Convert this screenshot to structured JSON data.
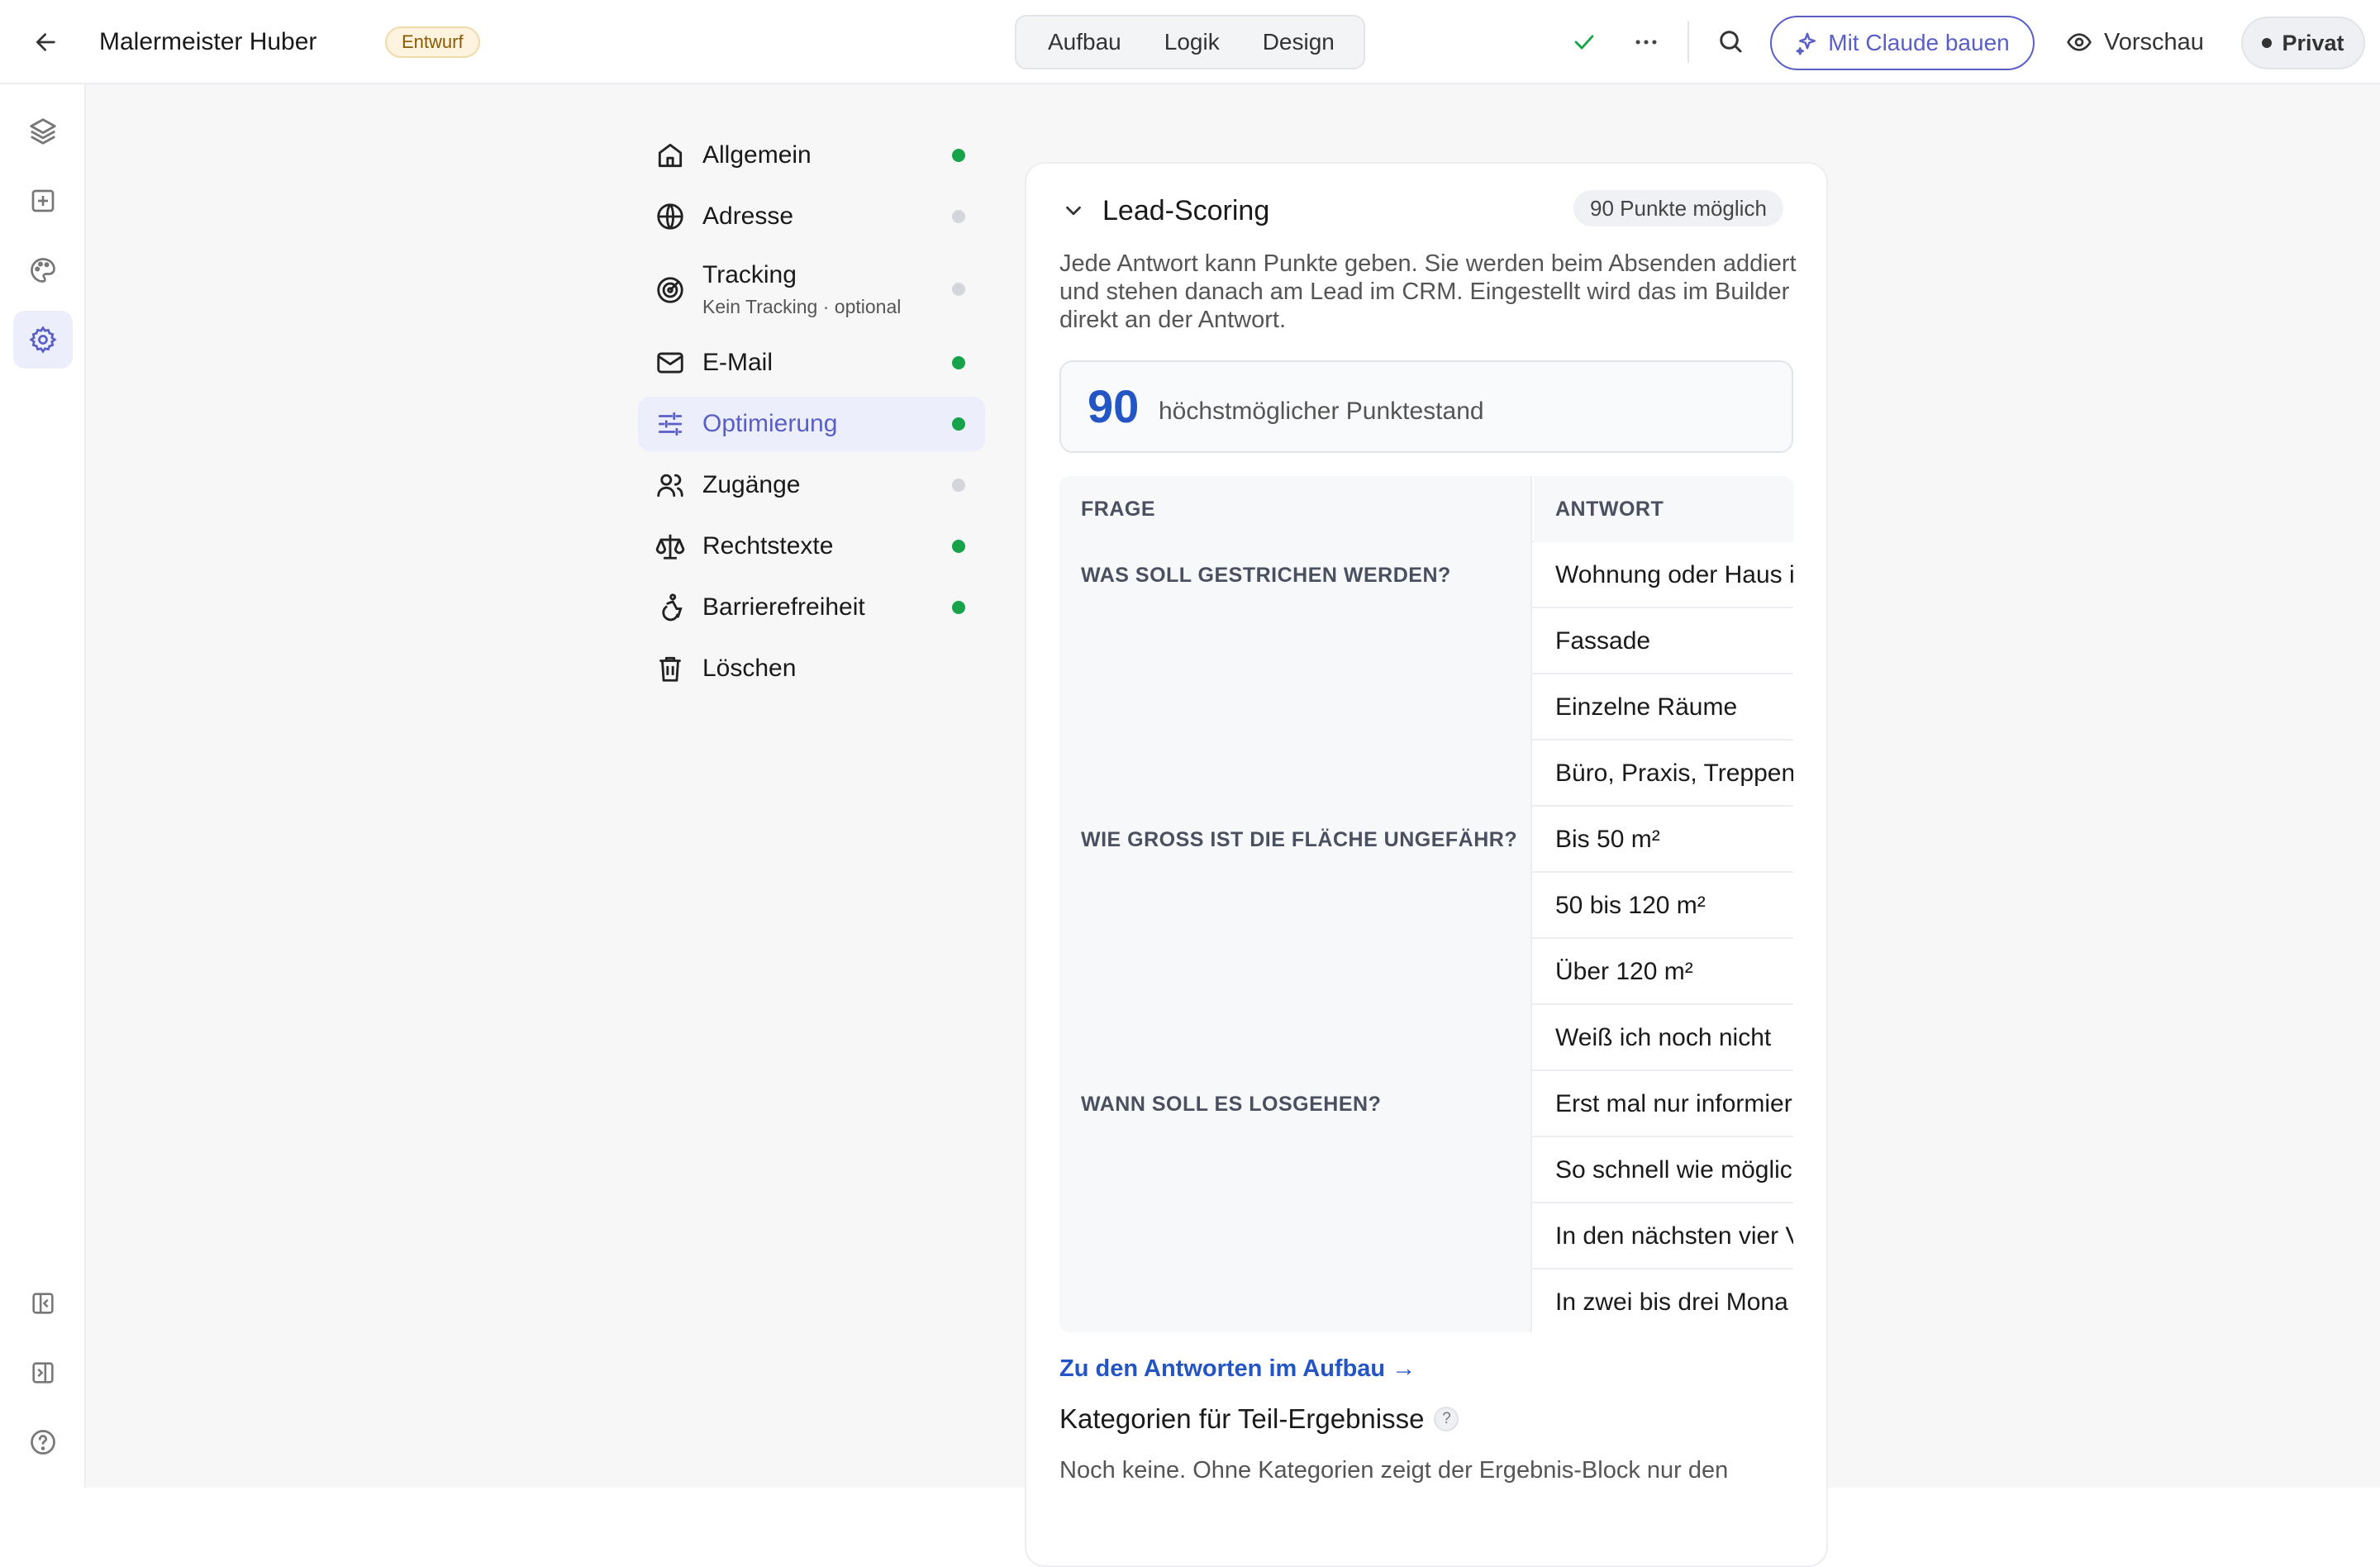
{
  "header": {
    "title": "Malermeister Huber",
    "status_badge": "Entwurf",
    "tabs": [
      {
        "label": "Aufbau"
      },
      {
        "label": "Logik"
      },
      {
        "label": "Design"
      }
    ],
    "claude_button": "Mit Claude bauen",
    "preview_button": "Vorschau",
    "visibility_button": "Privat"
  },
  "settings_nav": {
    "items": [
      {
        "label": "Allgemein",
        "status_color": "#16a34a"
      },
      {
        "label": "Adresse",
        "status_color": "#d4d6dc"
      },
      {
        "label": "Tracking",
        "sublabel": "Kein Tracking · optional",
        "status_color": "#d4d6dc"
      },
      {
        "label": "E-Mail",
        "status_color": "#16a34a"
      },
      {
        "label": "Optimierung",
        "status_color": "#16a34a",
        "active": true
      },
      {
        "label": "Zugänge",
        "status_color": "#d4d6dc"
      },
      {
        "label": "Rechtstexte",
        "status_color": "#16a34a"
      },
      {
        "label": "Barrierefreiheit",
        "status_color": "#16a34a"
      },
      {
        "label": "Löschen"
      }
    ]
  },
  "lead_scoring": {
    "title": "Lead-Scoring",
    "points_pill": "90 Punkte möglich",
    "description": "Jede Antwort kann Punkte geben. Sie werden beim Absenden addiert und stehen danach am Lead im CRM. Eingestellt wird das im Builder direkt an der Antwort.",
    "max_score": "90",
    "max_score_label": "höchstmöglicher Punktestand",
    "table": {
      "headers": [
        "FRAGE",
        "ANTWORT"
      ],
      "rows": [
        {
          "question": "WAS SOLL GESTRICHEN WERDEN?",
          "answer": "Wohnung oder Haus i"
        },
        {
          "question": "",
          "answer": "Fassade"
        },
        {
          "question": "",
          "answer": "Einzelne Räume"
        },
        {
          "question": "",
          "answer": "Büro, Praxis, Treppen"
        },
        {
          "question": "WIE GROSS IST DIE FLÄCHE UNGEFÄHR?",
          "answer": "Bis 50 m²"
        },
        {
          "question": "",
          "answer": "50 bis 120 m²"
        },
        {
          "question": "",
          "answer": "Über 120 m²"
        },
        {
          "question": "",
          "answer": "Weiß ich noch nicht"
        },
        {
          "question": "WANN SOLL ES LOSGEHEN?",
          "answer": "Erst mal nur informier"
        },
        {
          "question": "",
          "answer": "So schnell wie möglic"
        },
        {
          "question": "",
          "answer": "In den nächsten vier V"
        },
        {
          "question": "",
          "answer": "In zwei bis drei Mona"
        }
      ]
    },
    "answers_link": "Zu den Antworten im Aufbau →",
    "categories_title": "Kategorien für Teil-Ergebnisse",
    "categories_help": "?",
    "categories_text": "Noch keine. Ohne Kategorien zeigt der Ergebnis-Block nur den"
  },
  "theme": {
    "accent": "#5a5fc7",
    "link": "#2355c4",
    "success": "#16a34a"
  }
}
